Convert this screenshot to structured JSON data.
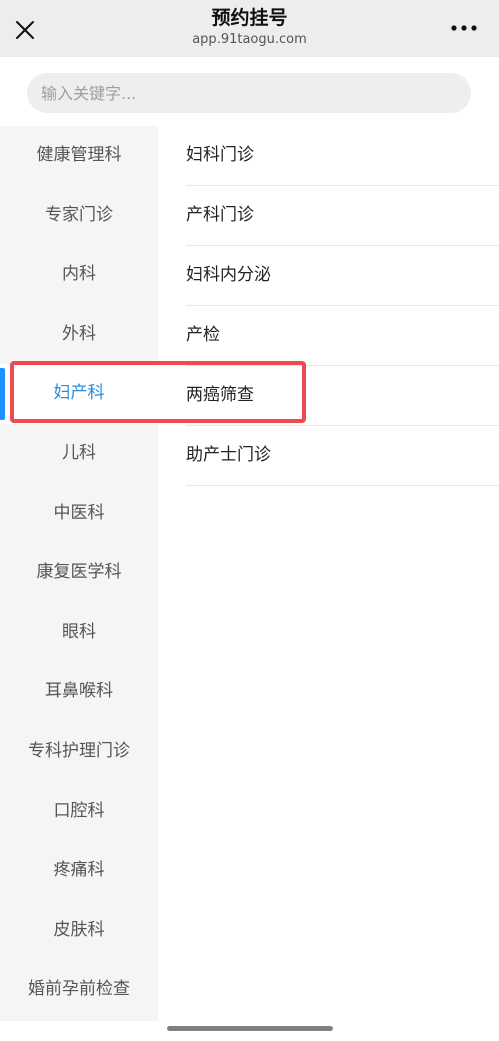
{
  "header": {
    "title": "预约挂号",
    "subtitle": "app.91taogu.com",
    "close_icon": "close-icon",
    "more_icon": "more-icon"
  },
  "search": {
    "placeholder": "输入关键字..."
  },
  "sidebar": {
    "active_index": 4,
    "items": [
      {
        "label": "健康管理科"
      },
      {
        "label": "专家门诊"
      },
      {
        "label": "内科"
      },
      {
        "label": "外科"
      },
      {
        "label": "妇产科"
      },
      {
        "label": "儿科"
      },
      {
        "label": "中医科"
      },
      {
        "label": "康复医学科"
      },
      {
        "label": "眼科"
      },
      {
        "label": "耳鼻喉科"
      },
      {
        "label": "专科护理门诊"
      },
      {
        "label": "口腔科"
      },
      {
        "label": "疼痛科"
      },
      {
        "label": "皮肤科"
      },
      {
        "label": "婚前孕前检查"
      }
    ]
  },
  "sublist": {
    "items": [
      {
        "label": "妇科门诊"
      },
      {
        "label": "产科门诊"
      },
      {
        "label": "妇科内分泌"
      },
      {
        "label": "产检"
      },
      {
        "label": "两癌筛查"
      },
      {
        "label": "助产士门诊"
      }
    ]
  },
  "colors": {
    "accent": "#2a8bd8",
    "highlight": "#ef4a52",
    "header_bg": "#ededed",
    "sidebar_bg": "#f5f5f5"
  }
}
